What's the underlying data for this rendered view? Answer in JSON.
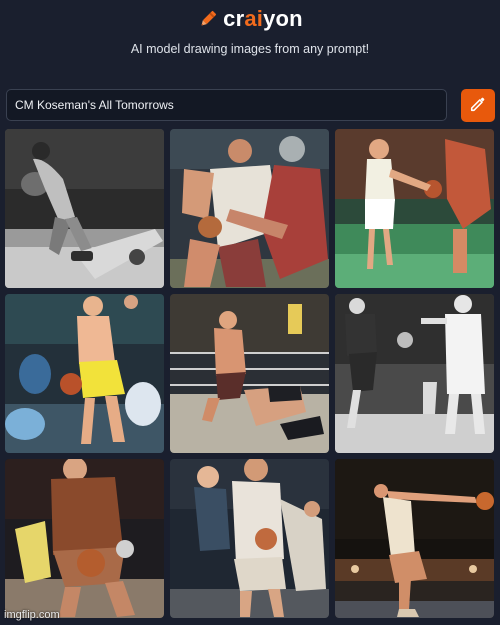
{
  "header": {
    "logo_prefix": "cr",
    "logo_accent": "ai",
    "logo_suffix": "yon",
    "tagline": "AI model drawing images from any prompt!"
  },
  "search": {
    "prompt_value": "CM Koseman's All Tomorrows"
  },
  "results": {
    "images": [
      {
        "subject": "grayscale basketball players"
      },
      {
        "subject": "two basketball players colliding"
      },
      {
        "subject": "player dribbling on green court"
      },
      {
        "subject": "bald player in yellow shorts"
      },
      {
        "subject": "wrestling ring scuffle"
      },
      {
        "subject": "monochrome players in white"
      },
      {
        "subject": "player in brown jersey crouching"
      },
      {
        "subject": "two players reaching for ball"
      },
      {
        "subject": "contorted figure on dark stage"
      }
    ]
  },
  "watermark": {
    "text": "imgflip.com"
  },
  "colors": {
    "background": "#1a1f2e",
    "accent": "#f26b1d",
    "button": "#e8590c"
  }
}
